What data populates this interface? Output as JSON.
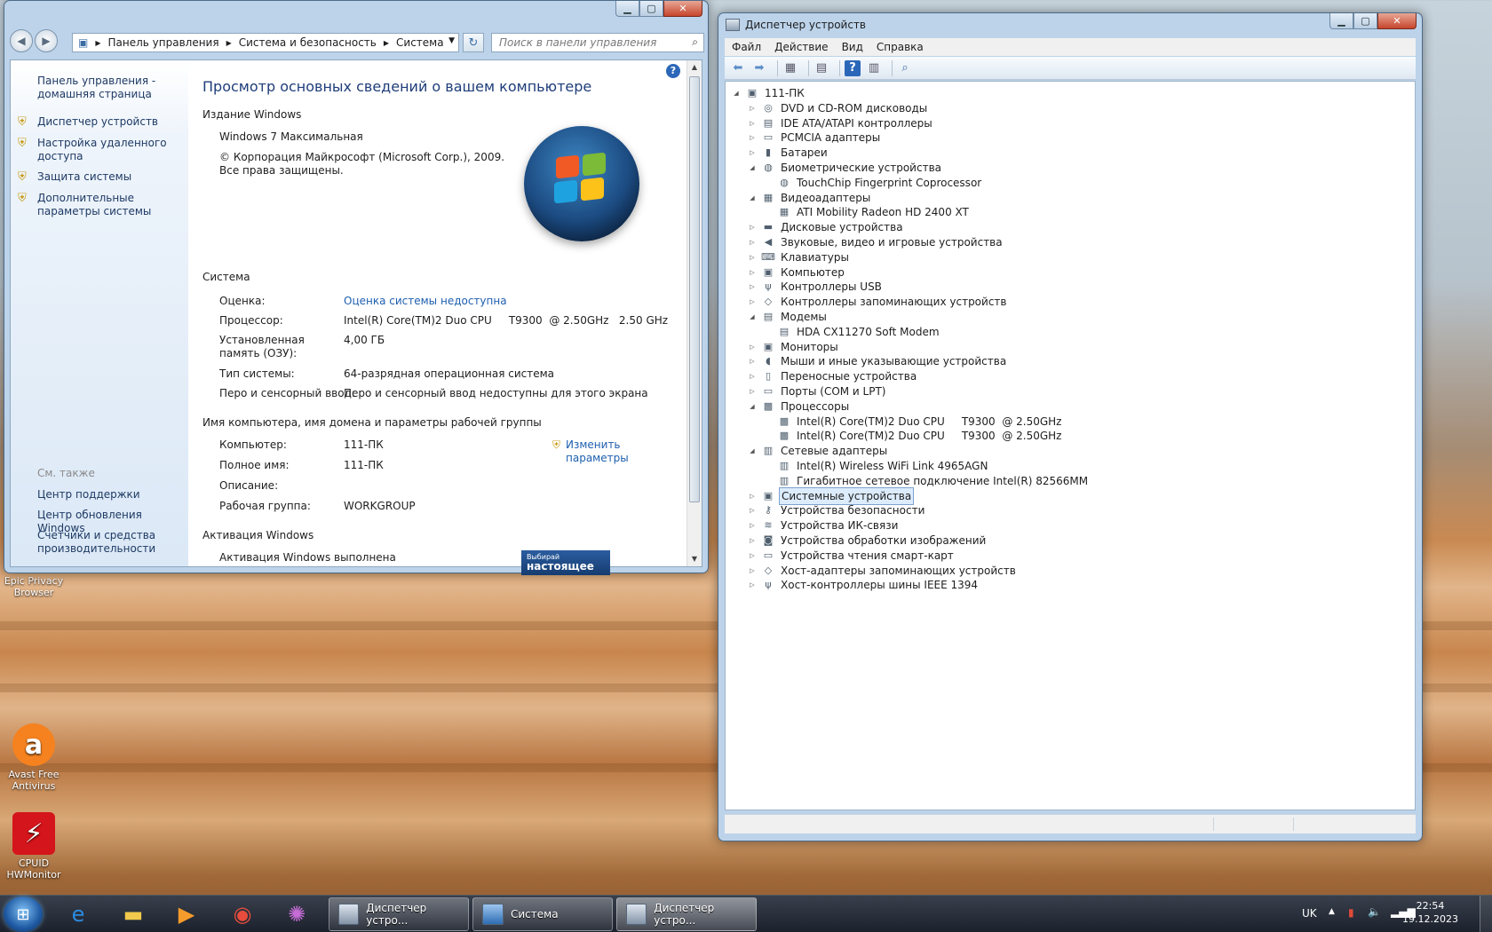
{
  "desktop": {
    "icons": [
      {
        "label": "Epic Privacy Browser"
      },
      {
        "label": "Avast Free Antivirus"
      },
      {
        "label": "CPUID HWMonitor"
      }
    ]
  },
  "control_panel": {
    "breadcrumb": [
      "Панель управления",
      "Система и безопасность",
      "Система"
    ],
    "search_placeholder": "Поиск в панели управления",
    "sidebar": {
      "home": "Панель управления - домашняя страница",
      "links": [
        "Диспетчер устройств",
        "Настройка удаленного доступа",
        "Защита системы",
        "Дополнительные параметры системы"
      ],
      "see_also": "См. также",
      "also_links": [
        "Центр поддержки",
        "Центр обновления Windows",
        "Счетчики и средства производительности"
      ]
    },
    "page_title": "Просмотр основных сведений о вашем компьютере",
    "edition": {
      "header": "Издание Windows",
      "name": "Windows 7 Максимальная",
      "copyright": "© Корпорация Майкрософт (Microsoft Corp.), 2009. Все права защищены."
    },
    "system": {
      "header": "Система",
      "rows": [
        {
          "key": "Оценка:",
          "value": "Оценка системы недоступна"
        },
        {
          "key": "Процессор:",
          "value": "Intel(R) Core(TM)2 Duo CPU     T9300  @ 2.50GHz   2.50 GHz"
        },
        {
          "key": "Установленная память (ОЗУ):",
          "value": "4,00 ГБ"
        },
        {
          "key": "Тип системы:",
          "value": "64-разрядная операционная система"
        },
        {
          "key": "Перо и сенсорный ввод:",
          "value": "Перо и сенсорный ввод недоступны для этого экрана"
        }
      ]
    },
    "computer": {
      "header": "Имя компьютера, имя домена и параметры рабочей группы",
      "change_link": "Изменить параметры",
      "rows": [
        {
          "key": "Компьютер:",
          "value": "111-ПК"
        },
        {
          "key": "Полное имя:",
          "value": "111-ПК"
        },
        {
          "key": "Описание:",
          "value": ""
        },
        {
          "key": "Рабочая группа:",
          "value": "WORKGROUP"
        }
      ]
    },
    "activation": {
      "header": "Активация Windows",
      "status": "Активация Windows выполнена",
      "genuine_small": "Выбирай",
      "genuine_big": "настоящее"
    }
  },
  "device_manager": {
    "title": "Диспетчер устройств",
    "menu": [
      "Файл",
      "Действие",
      "Вид",
      "Справка"
    ],
    "tree": [
      {
        "label": "111-ПК",
        "level": 0,
        "expanded": true,
        "icon": "computer-icon"
      },
      {
        "label": "DVD и CD-ROM дисководы",
        "level": 1,
        "expanded": false,
        "icon": "dvd-icon"
      },
      {
        "label": "IDE ATA/ATAPI контроллеры",
        "level": 1,
        "expanded": false,
        "icon": "ide-icon"
      },
      {
        "label": "PCMCIA адаптеры",
        "level": 1,
        "expanded": false,
        "icon": "pcmcia-icon"
      },
      {
        "label": "Батареи",
        "level": 1,
        "expanded": false,
        "icon": "battery-icon"
      },
      {
        "label": "Биометрические устройства",
        "level": 1,
        "expanded": true,
        "icon": "fingerprint-icon"
      },
      {
        "label": "TouchChip Fingerprint Coprocessor",
        "level": 2,
        "icon": "fingerprint-icon"
      },
      {
        "label": "Видеоадаптеры",
        "level": 1,
        "expanded": true,
        "icon": "display-adapter-icon"
      },
      {
        "label": "ATI Mobility Radeon HD 2400 XT",
        "level": 2,
        "icon": "display-adapter-icon"
      },
      {
        "label": "Дисковые устройства",
        "level": 1,
        "expanded": false,
        "icon": "disk-icon"
      },
      {
        "label": "Звуковые, видео и игровые устройства",
        "level": 1,
        "expanded": false,
        "icon": "speaker-icon"
      },
      {
        "label": "Клавиатуры",
        "level": 1,
        "expanded": false,
        "icon": "keyboard-icon"
      },
      {
        "label": "Компьютер",
        "level": 1,
        "expanded": false,
        "icon": "monitor-icon"
      },
      {
        "label": "Контроллеры USB",
        "level": 1,
        "expanded": false,
        "icon": "usb-icon"
      },
      {
        "label": "Контроллеры запоминающих устройств",
        "level": 1,
        "expanded": false,
        "icon": "storage-icon"
      },
      {
        "label": "Модемы",
        "level": 1,
        "expanded": true,
        "icon": "modem-icon"
      },
      {
        "label": "HDA CX11270 Soft Modem",
        "level": 2,
        "icon": "modem-icon"
      },
      {
        "label": "Мониторы",
        "level": 1,
        "expanded": false,
        "icon": "monitor-icon"
      },
      {
        "label": "Мыши и иные указывающие устройства",
        "level": 1,
        "expanded": false,
        "icon": "mouse-icon"
      },
      {
        "label": "Переносные устройства",
        "level": 1,
        "expanded": false,
        "icon": "portable-icon"
      },
      {
        "label": "Порты (COM и LPT)",
        "level": 1,
        "expanded": false,
        "icon": "port-icon"
      },
      {
        "label": "Процессоры",
        "level": 1,
        "expanded": true,
        "icon": "cpu-icon"
      },
      {
        "label": "Intel(R) Core(TM)2 Duo CPU     T9300  @ 2.50GHz",
        "level": 2,
        "icon": "cpu-icon"
      },
      {
        "label": "Intel(R) Core(TM)2 Duo CPU     T9300  @ 2.50GHz",
        "level": 2,
        "icon": "cpu-icon"
      },
      {
        "label": "Сетевые адаптеры",
        "level": 1,
        "expanded": true,
        "icon": "network-icon"
      },
      {
        "label": "Intel(R) Wireless WiFi Link 4965AGN",
        "level": 2,
        "icon": "network-icon"
      },
      {
        "label": "Гигабитное сетевое подключение Intel(R) 82566MM",
        "level": 2,
        "icon": "network-icon"
      },
      {
        "label": "Системные устройства",
        "level": 1,
        "expanded": false,
        "selected": true,
        "icon": "system-icon"
      },
      {
        "label": "Устройства безопасности",
        "level": 1,
        "expanded": false,
        "icon": "key-icon"
      },
      {
        "label": "Устройства ИК-связи",
        "level": 1,
        "expanded": false,
        "icon": "infrared-icon"
      },
      {
        "label": "Устройства обработки изображений",
        "level": 1,
        "expanded": false,
        "icon": "camera-icon"
      },
      {
        "label": "Устройства чтения смарт-карт",
        "level": 1,
        "expanded": false,
        "icon": "smartcard-icon"
      },
      {
        "label": "Хост-адаптеры запоминающих устройств",
        "level": 1,
        "expanded": false,
        "icon": "storage-icon"
      },
      {
        "label": "Хост-контроллеры шины IEEE 1394",
        "level": 1,
        "expanded": false,
        "icon": "firewire-icon"
      }
    ]
  },
  "taskbar": {
    "tasks": [
      "Диспетчер устро...",
      "Система",
      "Диспетчер устро..."
    ],
    "language": "UK",
    "time": "22:54",
    "date": "19.12.2023"
  }
}
